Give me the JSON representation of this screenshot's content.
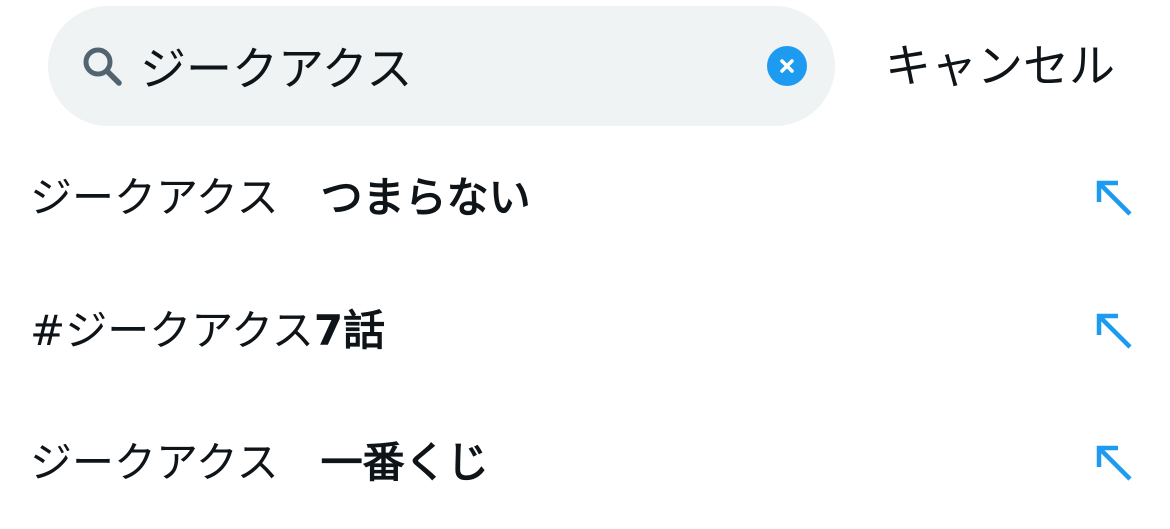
{
  "colors": {
    "accent": "#1d9bf0",
    "search_background": "#eff3f4",
    "text": "#0f1419",
    "icon_gray": "#536471",
    "background": "#ffffff"
  },
  "search": {
    "query": "ジークアクス",
    "search_icon": "search-icon",
    "clear_icon": "clear-icon"
  },
  "header": {
    "cancel_label": "キャンセル"
  },
  "suggestions": [
    {
      "query_part": "ジークアクス　",
      "completion": "つまらない",
      "icon": "arrow-up-left-icon"
    },
    {
      "query_part": "#ジークアクス",
      "completion": "7話",
      "icon": "arrow-up-left-icon"
    },
    {
      "query_part": "ジークアクス　",
      "completion": "一番くじ",
      "icon": "arrow-up-left-icon"
    }
  ]
}
